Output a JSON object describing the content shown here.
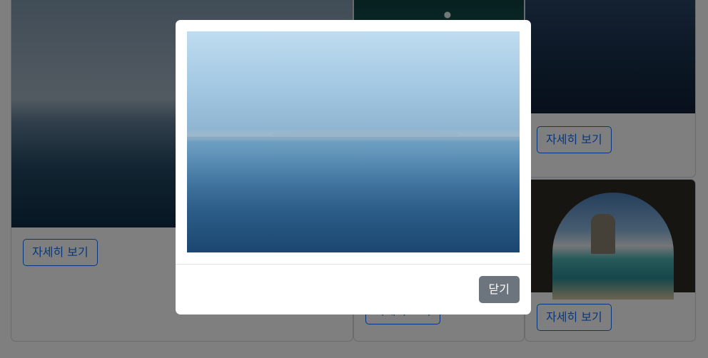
{
  "gallery": {
    "cards": [
      {
        "button_label": "자세히 보기"
      },
      {
        "button_label": "자세히 보기"
      },
      {
        "button_label": "자세히 보기"
      },
      {
        "button_label": "자세히 보기"
      }
    ]
  },
  "modal": {
    "close_label": "닫기"
  },
  "colors": {
    "primary": "#0d6efd",
    "secondary": "#6c757d",
    "backdrop": "rgba(0,0,0,0.5)"
  }
}
